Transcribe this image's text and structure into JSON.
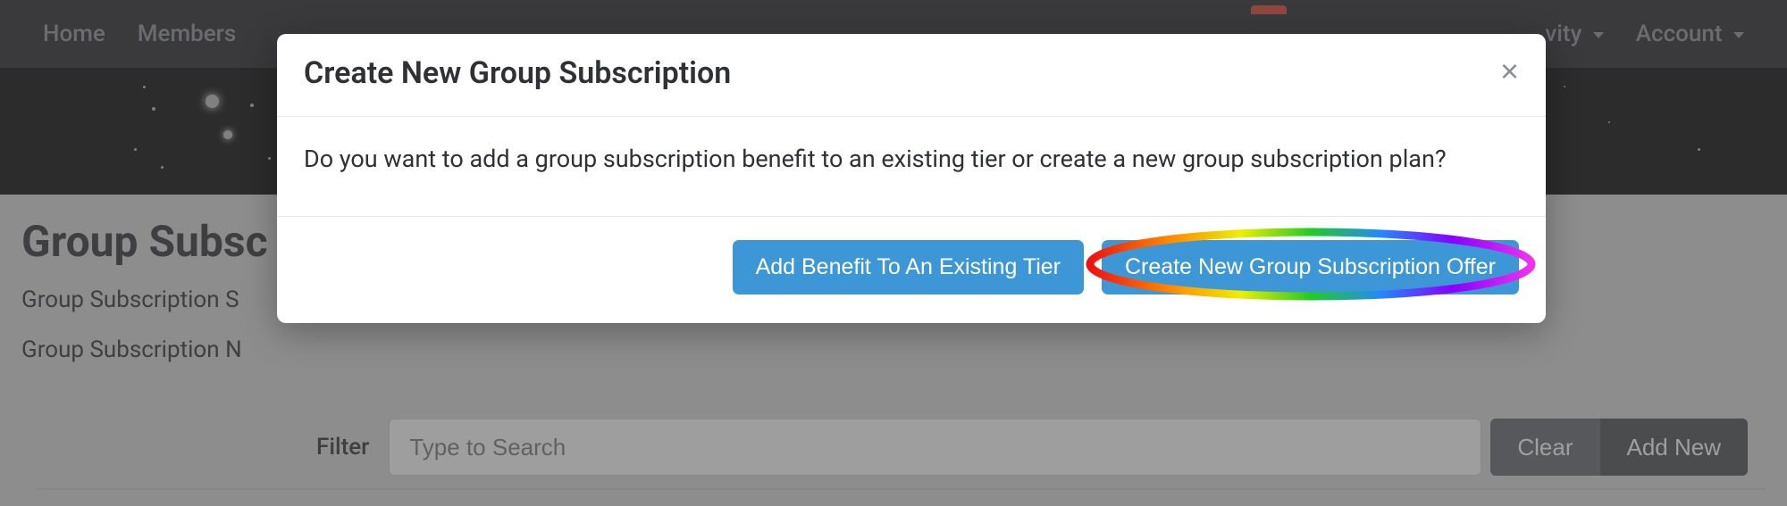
{
  "navbar": {
    "home": "Home",
    "members": "Members",
    "activity": "vity",
    "account": "Account"
  },
  "page": {
    "title": "Group Subsc",
    "row1": "Group Subscription S",
    "row2": "Group Subscription N",
    "filterLabel": "Filter",
    "filterPlaceholder": "Type to Search",
    "clear": "Clear",
    "addNew": "Add New"
  },
  "modal": {
    "title": "Create New Group Subscription",
    "body": "Do you want to add a group subscription benefit to an existing tier or create a new group subscription plan?",
    "btnAddBenefit": "Add Benefit To An Existing Tier",
    "btnCreateOffer": "Create New Group Subscription Offer"
  }
}
